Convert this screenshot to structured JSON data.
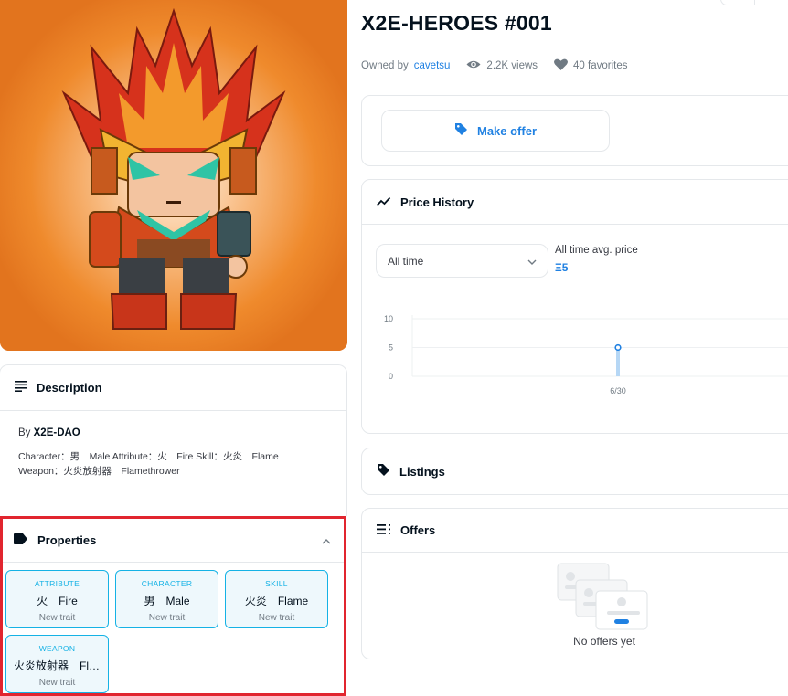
{
  "item": {
    "title": "X2E-HEROES #001",
    "owned_by_label": "Owned by",
    "owner": "cavetsu",
    "views": "2.2K views",
    "favorites": "40 favorites"
  },
  "offer": {
    "make_offer_label": "Make offer"
  },
  "description": {
    "title": "Description",
    "by_label": "By",
    "creator": "X2E-DAO",
    "line1": "Character：男　Male Attribute：火　Fire Skill：火炎　Flame",
    "line2": "Weapon：火炎放射器　Flamethrower"
  },
  "properties": {
    "title": "Properties",
    "traits": [
      {
        "type": "ATTRIBUTE",
        "value": "火　Fire",
        "rarity": "New trait"
      },
      {
        "type": "CHARACTER",
        "value": "男　Male",
        "rarity": "New trait"
      },
      {
        "type": "SKILL",
        "value": "火炎　Flame",
        "rarity": "New trait"
      },
      {
        "type": "WEAPON",
        "value": "火炎放射器　Flamethrower",
        "rarity": "New trait"
      }
    ]
  },
  "price_history": {
    "title": "Price History",
    "period": "All time",
    "avg_label": "All time avg. price",
    "avg_value": "Ξ5"
  },
  "listings": {
    "title": "Listings"
  },
  "offers": {
    "title": "Offers",
    "empty_text": "No offers yet"
  },
  "colors": {
    "accent": "#2081e2",
    "trait_border": "#15b2e5",
    "highlight": "#e1252f",
    "hero_bg": "#e2741e"
  },
  "chart_data": {
    "type": "line",
    "x": [
      "6/30"
    ],
    "series": [
      {
        "values": [
          5
        ]
      }
    ],
    "ylim": [
      0,
      10
    ],
    "yticks": [
      0,
      5,
      10
    ],
    "xlabel": "",
    "ylabel": ""
  }
}
